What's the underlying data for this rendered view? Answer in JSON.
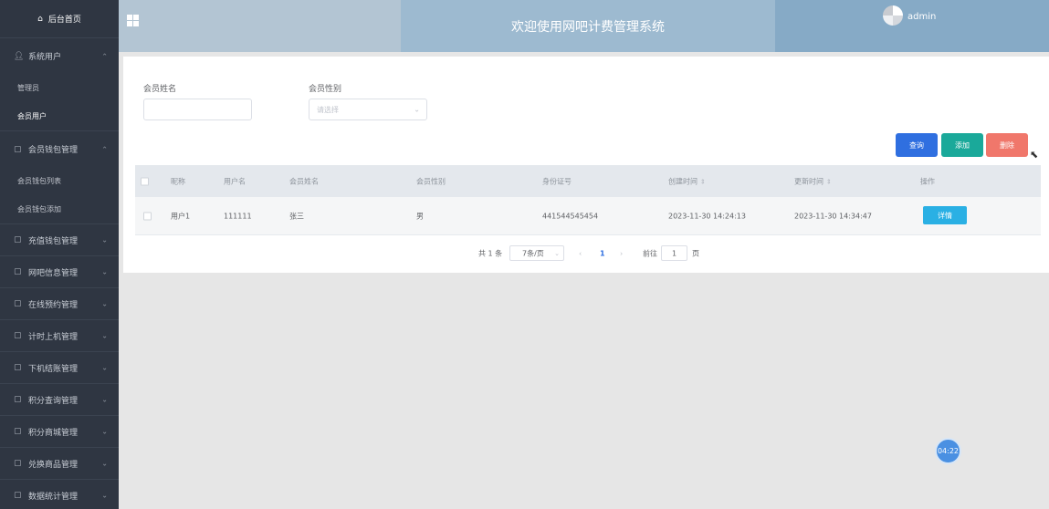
{
  "sidebar": {
    "home": "后台首页",
    "groups": [
      {
        "label": "系统用户",
        "icon": "user-icon",
        "expanded": true,
        "subs": [
          "管理员",
          "会员用户"
        ]
      },
      {
        "label": "会员钱包管理",
        "icon": "doc-icon",
        "expanded": true,
        "subs": [
          "会员钱包列表",
          "会员钱包添加"
        ]
      },
      {
        "label": "充值钱包管理",
        "icon": "doc-icon"
      },
      {
        "label": "网吧信息管理",
        "icon": "doc-icon"
      },
      {
        "label": "在线预约管理",
        "icon": "doc-icon"
      },
      {
        "label": "计时上机管理",
        "icon": "doc-icon"
      },
      {
        "label": "下机结账管理",
        "icon": "doc-icon"
      },
      {
        "label": "积分查询管理",
        "icon": "doc-icon"
      },
      {
        "label": "积分商城管理",
        "icon": "doc-icon"
      },
      {
        "label": "兑换商品管理",
        "icon": "doc-icon"
      },
      {
        "label": "数据统计管理",
        "icon": "doc-icon"
      }
    ]
  },
  "header": {
    "title": "欢迎使用网吧计费管理系统",
    "username": "admin"
  },
  "search": {
    "name_label": "会员姓名",
    "name_value": "",
    "gender_label": "会员性别",
    "gender_placeholder": "请选择"
  },
  "actions": {
    "query": "查询",
    "add": "添加",
    "delete": "删除"
  },
  "table": {
    "columns": [
      "昵称",
      "用户名",
      "会员姓名",
      "会员性别",
      "身份证号",
      "创建时间",
      "更新时间",
      "操作"
    ],
    "rows": [
      {
        "nickname": "用户1",
        "username": "111111",
        "name": "张三",
        "gender": "男",
        "id_number": "441544545454",
        "created": "2023-11-30 14:24:13",
        "updated": "2023-11-30 14:34:47",
        "action": "详情"
      }
    ]
  },
  "pagination": {
    "total": "共 1 条",
    "page_size": "7条/页",
    "current_page": "1",
    "goto_label": "前往",
    "goto_value": "1",
    "page_suffix": "页",
    "prev": "‹",
    "next": "›"
  },
  "timer": "04:22",
  "colors": {
    "sidebar_bg": "#2f3642",
    "header_mid": "#9dbad0",
    "query_btn": "#2f6fe0",
    "add_btn": "#1aa99a",
    "delete_btn": "#f0776b",
    "detail_btn": "#2ab0e4"
  }
}
